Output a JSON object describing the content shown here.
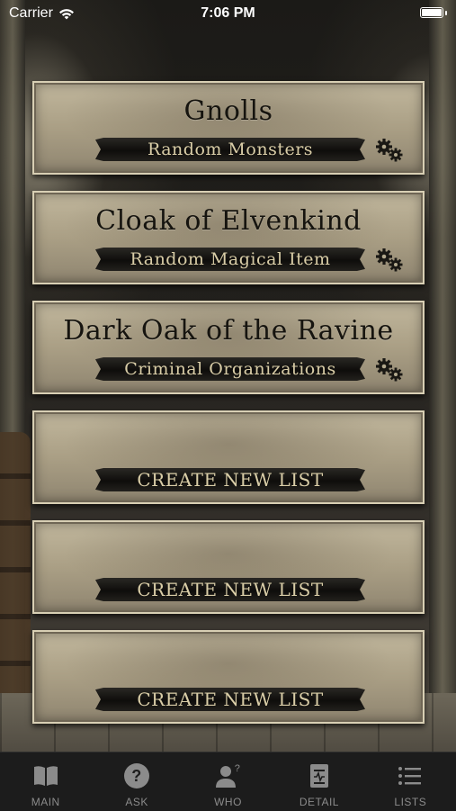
{
  "status_bar": {
    "carrier": "Carrier",
    "time": "7:06 PM"
  },
  "cards": [
    {
      "title": "Gnolls",
      "subtitle": "Random Monsters",
      "has_settings": true
    },
    {
      "title": "Cloak of Elvenkind",
      "subtitle": "Random Magical Item",
      "has_settings": true
    },
    {
      "title": "Dark Oak of the Ravine",
      "subtitle": "Criminal Organizations",
      "has_settings": true
    },
    {
      "title": "",
      "subtitle": "CREATE NEW LIST",
      "has_settings": false
    },
    {
      "title": "",
      "subtitle": "CREATE NEW LIST",
      "has_settings": false
    },
    {
      "title": "",
      "subtitle": "CREATE NEW LIST",
      "has_settings": false
    }
  ],
  "tabs": [
    {
      "label": "MAIN",
      "icon": "book-icon"
    },
    {
      "label": "ASK",
      "icon": "question-icon"
    },
    {
      "label": "WHO",
      "icon": "person-question-icon"
    },
    {
      "label": "DETAIL",
      "icon": "document-icon"
    },
    {
      "label": "LISTS",
      "icon": "list-icon"
    }
  ],
  "colors": {
    "card": "#b3a98e",
    "banner_text": "#d9cda7",
    "tab_bar": "#1c1c1c",
    "tab_text": "#8b8b8b"
  }
}
